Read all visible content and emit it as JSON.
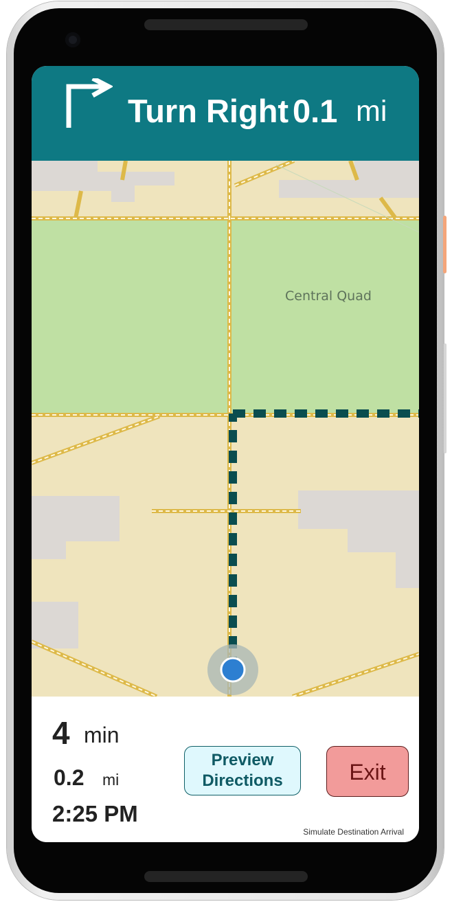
{
  "banner": {
    "instruction": "Turn Right",
    "distance_value": "0.1",
    "distance_unit": "mi",
    "icon": "turn-right-arrow-icon",
    "color": "#0e7983"
  },
  "map": {
    "place_label": "Central Quad",
    "route_color": "#0a4d4f",
    "user_location_color": "#2d7fd1"
  },
  "trip": {
    "time_value": "4",
    "time_unit": "min",
    "distance_value": "0.2",
    "distance_unit": "mi",
    "arrival_time": "2:25 PM"
  },
  "buttons": {
    "preview_label": "Preview Directions",
    "exit_label": "Exit",
    "simulate_label": "Simulate Destination Arrival"
  }
}
